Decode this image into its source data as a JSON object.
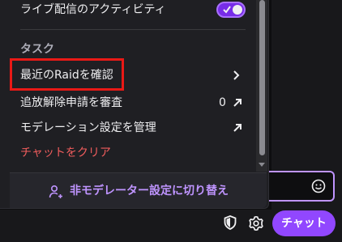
{
  "menu": {
    "activity_label": "ライブ配信のアクティビティ",
    "tasks_heading": "タスク",
    "items": [
      {
        "label": "最近のRaidを確認"
      },
      {
        "label": "追放解除申請を審査",
        "count": "0"
      },
      {
        "label": "モデレーション設定を管理"
      },
      {
        "label": "チャットをクリア"
      }
    ],
    "footer_label": "非モデレーター設定に切り替え"
  },
  "chat": {
    "button_label": "チャット"
  },
  "icons": {
    "toggle_check": "check-icon",
    "chevron": "chevron-right-icon",
    "external": "arrow-up-right-icon",
    "footer": "user-swap-icon",
    "emote": "smiley-icon",
    "shield": "shield-icon",
    "gear": "gear-icon"
  },
  "colors": {
    "accent": "#9147ff",
    "accent_text": "#bf94ff",
    "danger_text": "#f15d5d",
    "highlight_border": "#e91916"
  },
  "toggle": {
    "on": true
  }
}
